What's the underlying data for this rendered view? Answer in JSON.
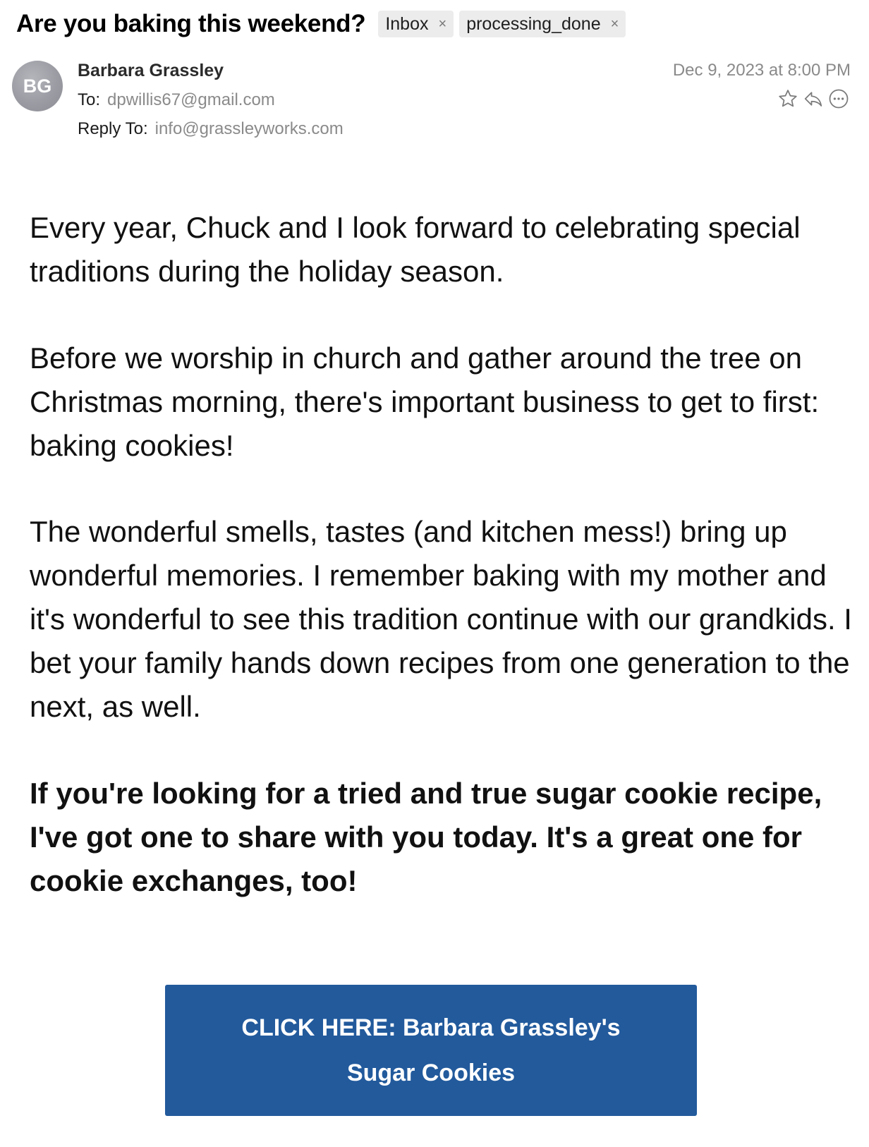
{
  "email": {
    "subject": "Are you baking this weekend?",
    "tags": [
      {
        "label": "Inbox",
        "remove": "×"
      },
      {
        "label": "processing_done",
        "remove": "×"
      }
    ],
    "sender": {
      "initials": "BG",
      "name": "Barbara Grassley"
    },
    "to_label": "To:",
    "to_value": "dpwillis67@gmail.com",
    "reply_to_label": "Reply To:",
    "reply_to_value": "info@grassleyworks.com",
    "date": "Dec 9, 2023 at 8:00 PM",
    "actions": [
      "star-icon",
      "reply-icon",
      "more-icon"
    ]
  },
  "body": {
    "paragraphs": [
      "Every year, Chuck and I look forward to celebrating special traditions during the holiday season.",
      "Before we worship in church and gather around the tree on Christmas morning, there's important business to get to first: baking cookies!",
      "The wonderful smells, tastes (and kitchen mess!) bring up wonderful memories. I remember baking with my mother and it's wonderful to see this tradition continue with our grandkids. I bet your family hands down recipes from one generation to the next, as well.",
      "If you're looking for a tried and true sugar cookie recipe, I've got one to share with you today. It's a great one for cookie exchanges, too!"
    ],
    "cta_line1": "CLICK HERE: Barbara Grassley's",
    "cta_line2": "Sugar Cookies",
    "cta_color": "#225a9c"
  }
}
